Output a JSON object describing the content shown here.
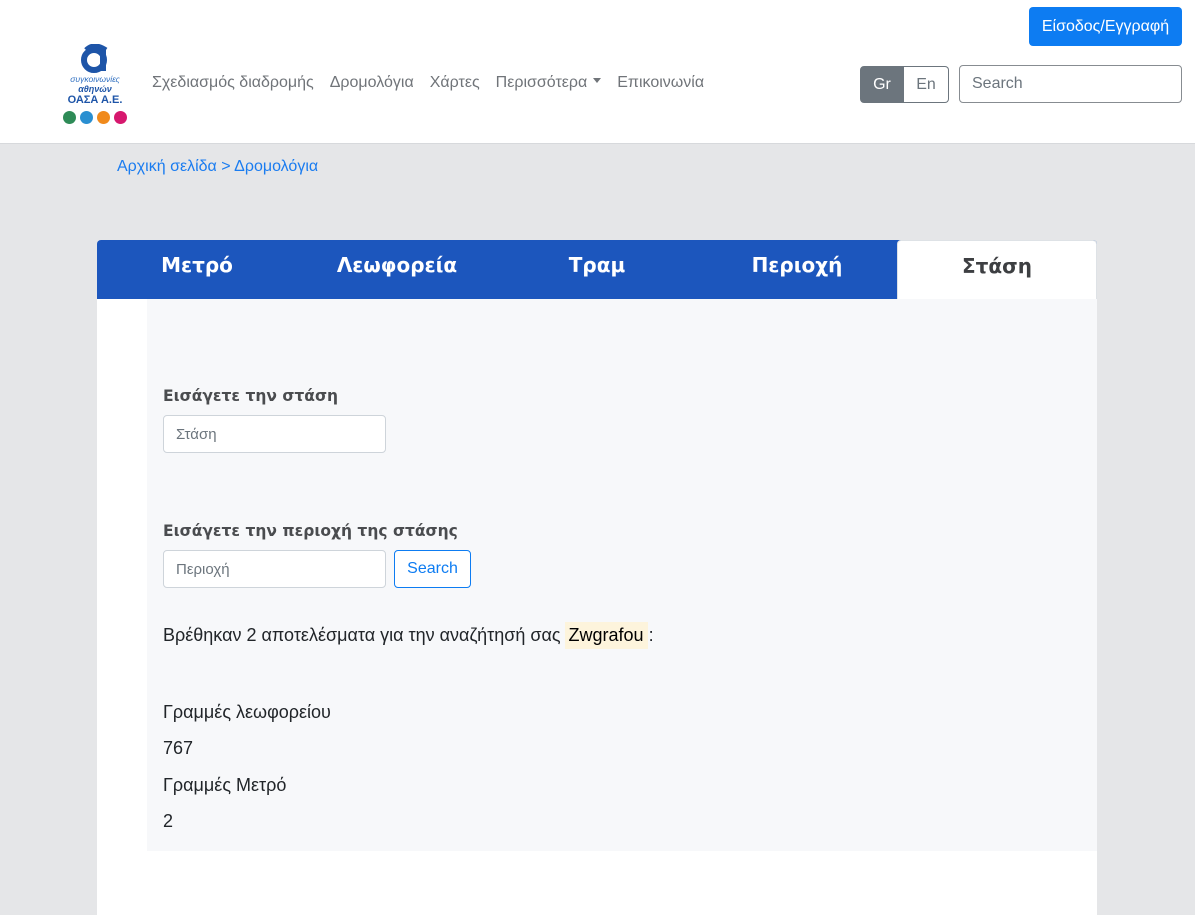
{
  "header": {
    "login_label": "Είσοδος/Εγγραφή",
    "logo": {
      "line1": "συγκοινωνίες",
      "line2": "αθηνών",
      "line3": "ΟΑΣΑ Α.Ε."
    },
    "nav": [
      {
        "label": "Σχεδιασμός διαδρομής"
      },
      {
        "label": "Δρομολόγια"
      },
      {
        "label": "Χάρτες"
      },
      {
        "label": "Περισσότερα"
      },
      {
        "label": "Επικοινωνία"
      }
    ],
    "lang_gr": "Gr",
    "lang_en": "En",
    "search_placeholder": "Search"
  },
  "breadcrumb": {
    "home": "Αρχική σελίδα",
    "separator": " > ",
    "current": "Δρομολόγια"
  },
  "tabs": [
    {
      "label": "Μετρό"
    },
    {
      "label": "Λεωφορεία"
    },
    {
      "label": "Τραμ"
    },
    {
      "label": "Περιοχή"
    },
    {
      "label": "Στάση",
      "active": true
    }
  ],
  "form": {
    "stop_label": "Εισάγετε την στάση",
    "stop_placeholder": "Στάση",
    "area_label": "Εισάγετε την περιοχή της στάσης",
    "area_placeholder": "Περιοχή",
    "search_label": "Search"
  },
  "results": {
    "prefix": "Βρέθηκαν 2 αποτελέσματα για την αναζήτησή σας",
    "query": "Zwgrafou",
    "suffix": ":",
    "bus_heading": "Γραμμές λεωφορείου",
    "bus_value": "767",
    "metro_heading": "Γραμμές Μετρό",
    "metro_value": "2"
  },
  "colors": {
    "primary": "#0d7cf2",
    "tab_bar": "#1c56bd",
    "highlight": "#fdf4dc"
  }
}
